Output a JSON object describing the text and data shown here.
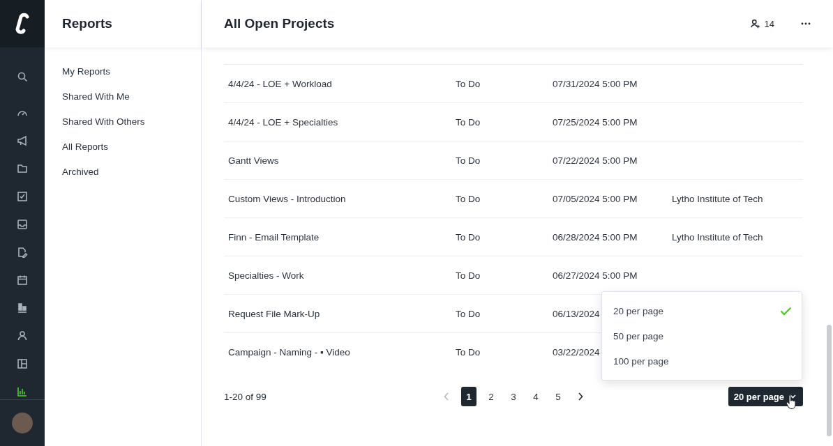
{
  "rail": [
    {
      "selected": false
    },
    {
      "selected": false
    },
    {
      "selected": false
    },
    {
      "selected": false
    },
    {
      "selected": false
    },
    {
      "selected": false
    },
    {
      "selected": false
    },
    {
      "selected": false
    },
    {
      "selected": false
    },
    {
      "selected": false
    },
    {
      "selected": false
    },
    {
      "selected": true
    }
  ],
  "panel": {
    "title": "Reports",
    "items": [
      "My Reports",
      "Shared With Me",
      "Shared With Others",
      "All Reports",
      "Archived"
    ]
  },
  "header": {
    "title": "All Open Projects",
    "members": "14"
  },
  "rows": [
    {
      "name": "4/4/24 - LOE + Workload",
      "status": "To Do",
      "due": "07/31/2024 5:00 PM",
      "client": ""
    },
    {
      "name": "4/4/24 - LOE + Specialties",
      "status": "To Do",
      "due": "07/25/2024 5:00 PM",
      "client": ""
    },
    {
      "name": "Gantt Views",
      "status": "To Do",
      "due": "07/22/2024 5:00 PM",
      "client": ""
    },
    {
      "name": "Custom Views - Introduction",
      "status": "To Do",
      "due": "07/05/2024 5:00 PM",
      "client": "Lytho Institute of Tech"
    },
    {
      "name": "Finn - Email Template",
      "status": "To Do",
      "due": "06/28/2024 5:00 PM",
      "client": "Lytho Institute of Tech"
    },
    {
      "name": "Specialties - Work",
      "status": "To Do",
      "due": "06/27/2024 5:00 PM",
      "client": ""
    },
    {
      "name": "Request File Mark-Up",
      "status": "To Do",
      "due": "06/13/2024",
      "client": ""
    },
    {
      "name": "Campaign - Naming - ▪ Video",
      "status": "To Do",
      "due": "03/22/2024",
      "client": ""
    }
  ],
  "pagination": {
    "range": "1-20 of 99",
    "pages": [
      {
        "label": "1",
        "selected": true
      },
      {
        "label": "2",
        "selected": false
      },
      {
        "label": "3",
        "selected": false
      },
      {
        "label": "4",
        "selected": false
      },
      {
        "label": "5",
        "selected": false
      }
    ],
    "page_size": "20 per page"
  },
  "page_size_menu": [
    {
      "label": "20 per page",
      "selected": true
    },
    {
      "label": "50 per page",
      "selected": false
    },
    {
      "label": "100 per page",
      "selected": false
    }
  ]
}
